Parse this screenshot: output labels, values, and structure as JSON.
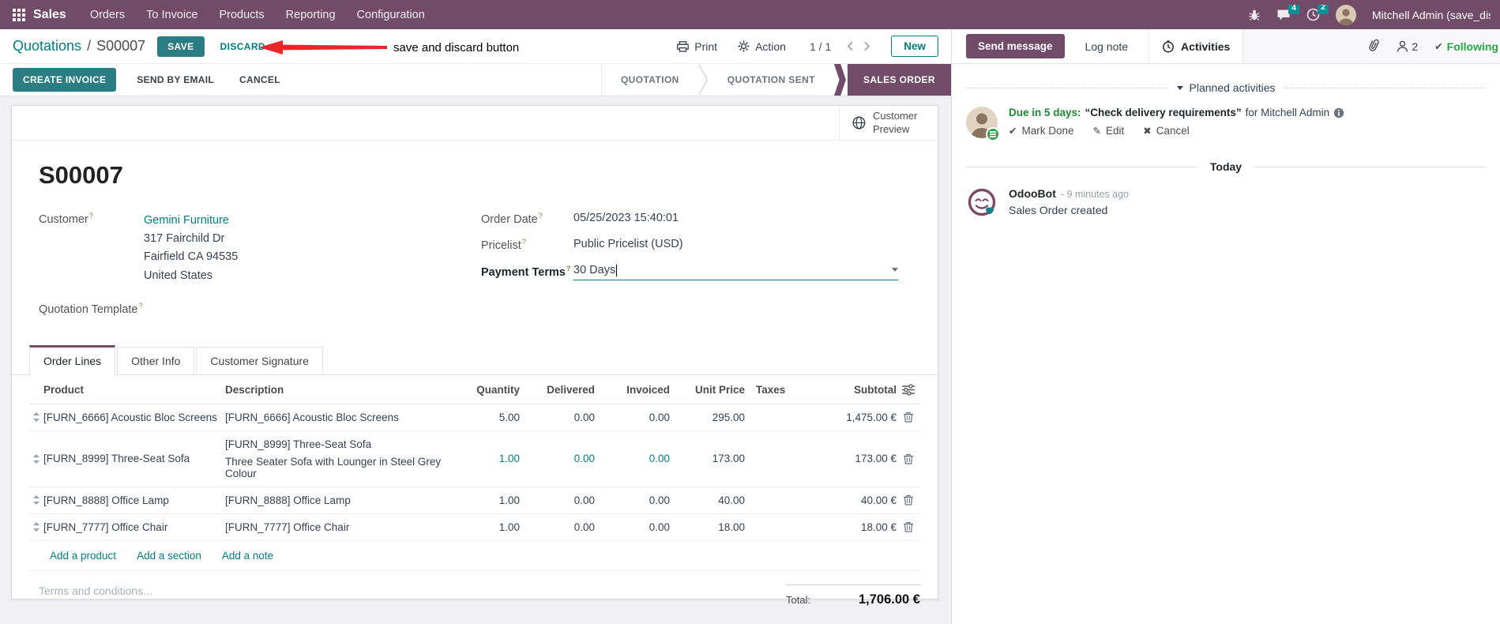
{
  "colors": {
    "brand_purple": "#714B67",
    "primary_teal": "#017E84",
    "badge_teal": "#0B8E96",
    "success_green": "#28a745",
    "annotation_red": "#E8262C"
  },
  "nav": {
    "app_name": "Sales",
    "menus": [
      "Orders",
      "To Invoice",
      "Products",
      "Reporting",
      "Configuration"
    ],
    "messages_badge": "4",
    "activities_badge": "2",
    "user_name": "Mitchell Admin (save_discard"
  },
  "control_panel": {
    "breadcrumb": {
      "parent": "Quotations",
      "separator": "/",
      "current": "S00007"
    },
    "save_label": "SAVE",
    "discard_label": "DISCARD",
    "annotation_text": "save and discard button",
    "print_label": "Print",
    "action_label": "Action",
    "pager": "1 / 1",
    "new_label": "New"
  },
  "status_bar": {
    "create_invoice_label": "CREATE INVOICE",
    "send_by_email_label": "SEND BY EMAIL",
    "cancel_label": "CANCEL",
    "stages": [
      "QUOTATION",
      "QUOTATION SENT",
      "SALES ORDER"
    ],
    "active_stage": "SALES ORDER"
  },
  "form": {
    "customer_preview_label": "Customer Preview",
    "record_name": "S00007",
    "help_marker": "?",
    "customer_label": "Customer",
    "customer_name": "Gemini Furniture",
    "address_line1": "317 Fairchild Dr",
    "address_line2": "Fairfield CA 94535",
    "address_line3": "United States",
    "quotation_template_label": "Quotation Template",
    "order_date_label": "Order Date",
    "order_date_value": "05/25/2023 15:40:01",
    "pricelist_label": "Pricelist",
    "pricelist_value": "Public Pricelist (USD)",
    "payment_terms_label": "Payment Terms",
    "payment_terms_value": "30 Days",
    "tabs": [
      "Order Lines",
      "Other Info",
      "Customer Signature"
    ],
    "table": {
      "headers": {
        "product": "Product",
        "description": "Description",
        "quantity": "Quantity",
        "delivered": "Delivered",
        "invoiced": "Invoiced",
        "unit_price": "Unit Price",
        "taxes": "Taxes",
        "subtotal": "Subtotal"
      },
      "rows": [
        {
          "product": "[FURN_6666] Acoustic Bloc Screens",
          "description": "[FURN_6666] Acoustic Bloc Screens",
          "description_extra": "",
          "quantity": "5.00",
          "delivered": "0.00",
          "invoiced": "0.00",
          "unit_price": "295.00",
          "taxes": "",
          "subtotal": "1,475.00 €"
        },
        {
          "product": "[FURN_8999] Three-Seat Sofa",
          "description": "[FURN_8999] Three-Seat Sofa",
          "description_extra": "Three Seater Sofa with Lounger in Steel Grey Colour",
          "quantity": "1.00",
          "delivered": "0.00",
          "invoiced": "0.00",
          "unit_price": "173.00",
          "taxes": "",
          "subtotal": "173.00 €"
        },
        {
          "product": "[FURN_8888] Office Lamp",
          "description": "[FURN_8888] Office Lamp",
          "description_extra": "",
          "quantity": "1.00",
          "delivered": "0.00",
          "invoiced": "0.00",
          "unit_price": "40.00",
          "taxes": "",
          "subtotal": "40.00 €"
        },
        {
          "product": "[FURN_7777] Office Chair",
          "description": "[FURN_7777] Office Chair",
          "description_extra": "",
          "quantity": "1.00",
          "delivered": "0.00",
          "invoiced": "0.00",
          "unit_price": "18.00",
          "taxes": "",
          "subtotal": "18.00 €"
        }
      ],
      "add_product_label": "Add a product",
      "add_section_label": "Add a section",
      "add_note_label": "Add a note"
    },
    "terms_placeholder": "Terms and conditions...",
    "total_label": "Total:",
    "total_value": "1,706.00 €"
  },
  "chatter": {
    "send_message_label": "Send message",
    "log_note_label": "Log note",
    "activities_label": "Activities",
    "followers_count": "2",
    "following_label": "Following",
    "planned_activities_label": "Planned activities",
    "activity": {
      "due_text": "Due in 5 days:",
      "summary": "“Check delivery requirements”",
      "assignee_text": "for Mitchell Admin",
      "mark_done_label": "Mark Done",
      "edit_label": "Edit",
      "cancel_label": "Cancel"
    },
    "today_label": "Today",
    "message": {
      "author": "OdooBot",
      "time": "- 9 minutes ago",
      "body": "Sales Order created"
    }
  },
  "icons": {
    "check_glyph": "✔",
    "pencil_glyph": "✎",
    "cross_glyph": "✖"
  }
}
